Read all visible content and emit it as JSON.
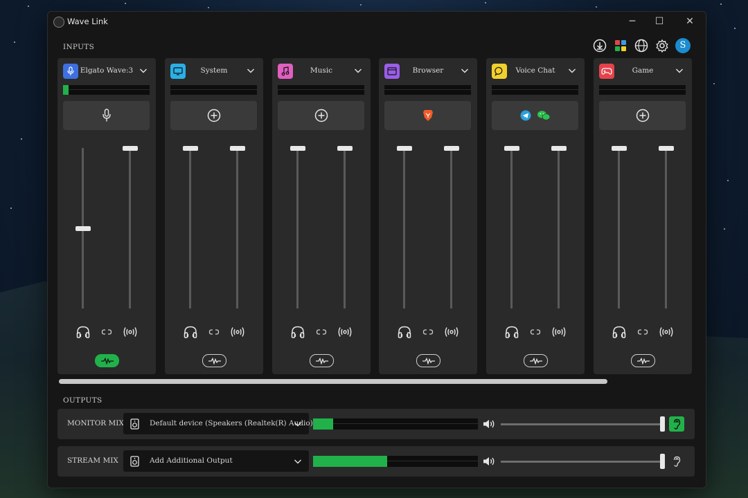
{
  "window": {
    "title": "Wave Link",
    "minimize": "─",
    "maximize": "☐",
    "close": "✕"
  },
  "sections": {
    "inputs": "INPUTS",
    "outputs": "OUTPUTS"
  },
  "toolbar": {
    "avatar_letter": "S"
  },
  "colors": {
    "accent_green": "#21b14a",
    "panel": "#2a2a2a",
    "window_bg": "#161616"
  },
  "channels": [
    {
      "name": "Elgato Wave:3",
      "icon": "mic-icon",
      "color": "#3d6fe0",
      "meter_level": 0.06,
      "volume_left": 0.5,
      "volume_right": 1.0,
      "sources": [
        "mic-icon"
      ],
      "effects_on": true
    },
    {
      "name": "System",
      "icon": "monitor-icon",
      "color": "#2ab0e6",
      "meter_level": 0,
      "volume_left": 1.0,
      "volume_right": 1.0,
      "sources": [
        "add-source-icon"
      ],
      "effects_on": false
    },
    {
      "name": "Music",
      "icon": "music-note-icon",
      "color": "#e05fbf",
      "meter_level": 0,
      "volume_left": 1.0,
      "volume_right": 1.0,
      "sources": [
        "add-source-icon"
      ],
      "effects_on": false
    },
    {
      "name": "Browser",
      "icon": "browser-window-icon",
      "color": "#9a5ee8",
      "meter_level": 0,
      "volume_left": 1.0,
      "volume_right": 1.0,
      "sources": [
        "brave-browser-icon"
      ],
      "effects_on": false
    },
    {
      "name": "Voice Chat",
      "icon": "chat-bubble-icon",
      "color": "#f1d02b",
      "meter_level": 0,
      "volume_left": 1.0,
      "volume_right": 1.0,
      "sources": [
        "telegram-icon",
        "wechat-icon"
      ],
      "effects_on": false
    },
    {
      "name": "Game",
      "icon": "gamepad-icon",
      "color": "#e5424b",
      "meter_level": 0,
      "volume_left": 1.0,
      "volume_right": 1.0,
      "sources": [
        "add-source-icon"
      ],
      "effects_on": false
    }
  ],
  "outputs": [
    {
      "label": "MONITOR MIX",
      "device": "Default device (Speakers (Realtek(R) Audio))",
      "meter_level": 0.12,
      "volume": 1.0,
      "listen_on": true
    },
    {
      "label": "STREAM MIX",
      "device": "Add Additional Output",
      "meter_level": 0.45,
      "volume": 1.0,
      "listen_on": false
    }
  ]
}
